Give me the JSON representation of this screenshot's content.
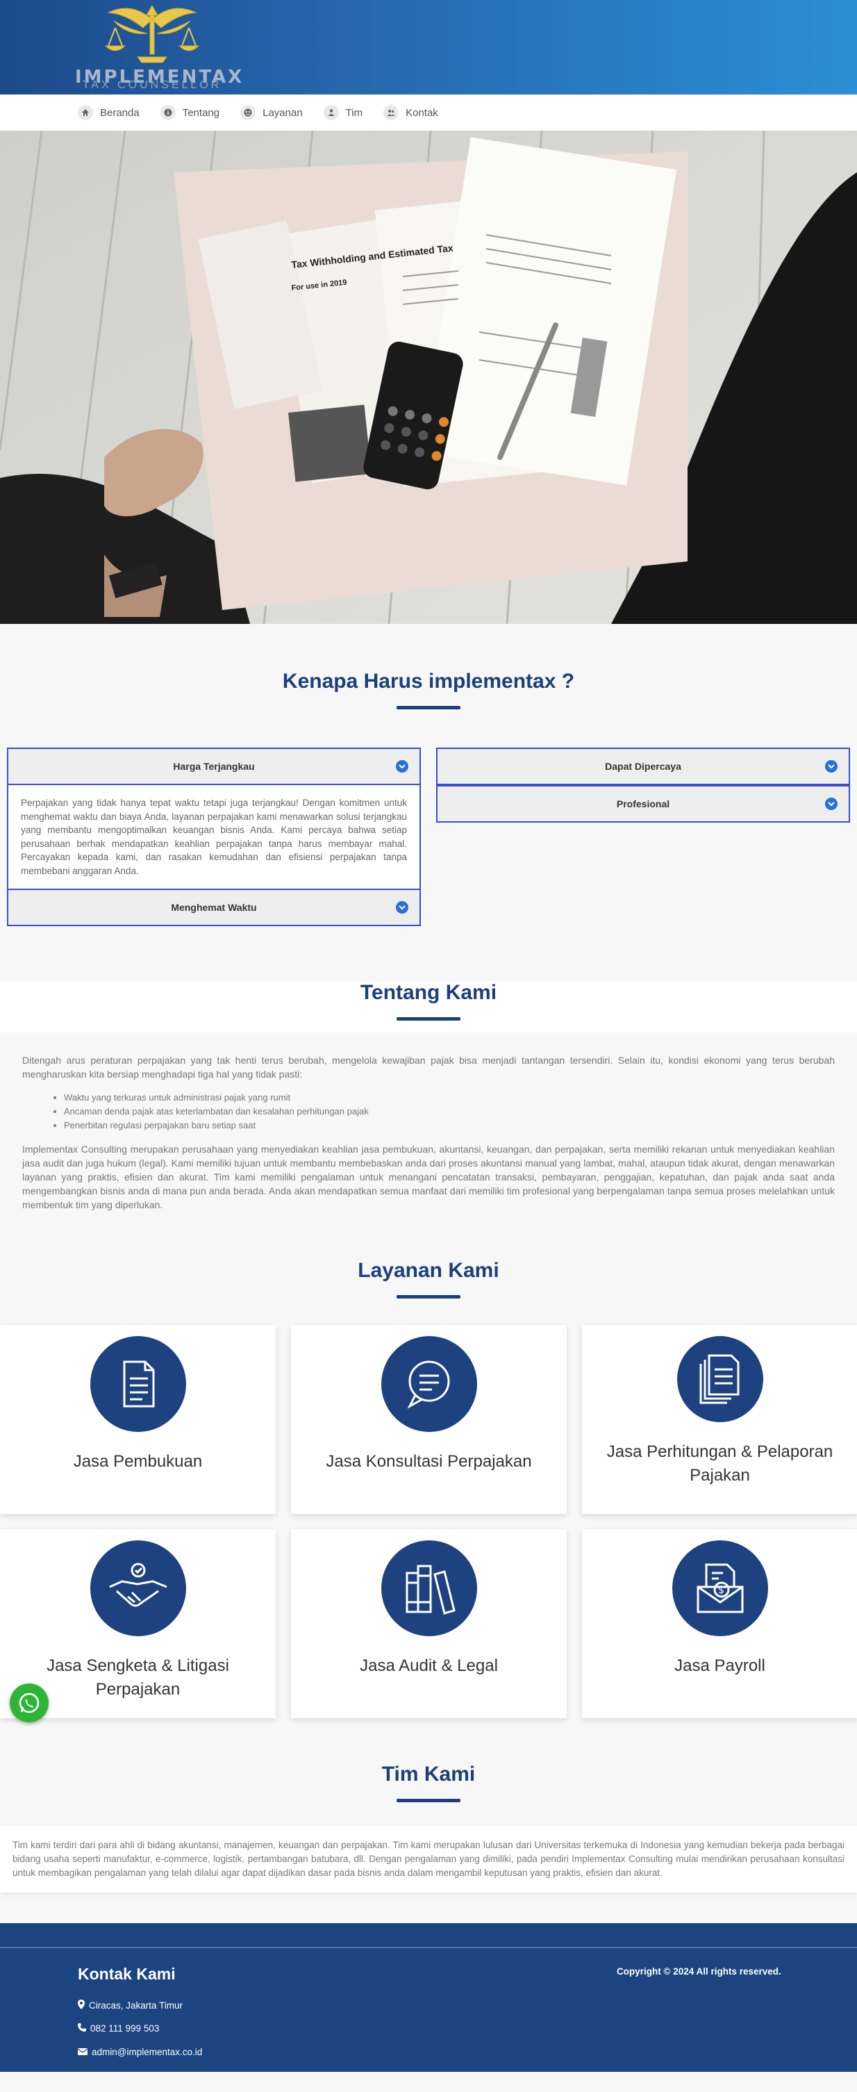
{
  "brand": {
    "name": "IMPLEMENTAX",
    "tagline": "TAX COUNSELLOR",
    "icon": "scales-eagle-logo"
  },
  "nav": [
    {
      "label": "Beranda",
      "icon": "home-icon"
    },
    {
      "label": "Tentang",
      "icon": "info-icon"
    },
    {
      "label": "Layanan",
      "icon": "services-icon"
    },
    {
      "label": "Tim",
      "icon": "team-icon"
    },
    {
      "label": "Kontak",
      "icon": "contact-icon"
    }
  ],
  "hero": {
    "doc_title": "Tax Withholding and Estimated Tax",
    "doc_year": "For use in 2019"
  },
  "why": {
    "title": "Kenapa Harus implementax ?",
    "left": [
      {
        "label": "Harga Terjangkau",
        "expanded": true,
        "body": "Perpajakan yang tidak hanya tepat waktu tetapi juga terjangkau! Dengan komitmen untuk menghemat waktu dan biaya Anda, layanan perpajakan kami menawarkan solusi terjangkau yang membantu mengoptimalkan keuangan bisnis Anda. Kami percaya bahwa setiap perusahaan berhak mendapatkan keahlian perpajakan tanpa harus membayar mahal. Percayakan kepada kami, dan rasakan kemudahan dan efisiensi perpajakan tanpa membebani anggaran Anda."
      },
      {
        "label": "Menghemat Waktu",
        "expanded": false
      }
    ],
    "right": [
      {
        "label": "Dapat Dipercaya",
        "expanded": false
      },
      {
        "label": "Profesional",
        "expanded": false
      }
    ]
  },
  "about": {
    "title": "Tentang Kami",
    "intro": "Ditengah arus peraturan perpajakan yang tak henti terus berubah, mengelola kewajiban pajak bisa menjadi tantangan tersendiri. Selain itu, kondisi ekonomi yang terus berubah mengharuskan kita bersiap menghadapi tiga hal yang tidak pasti:",
    "points": [
      "Waktu yang terkuras untuk administrasi pajak yang rumit",
      "Ancaman denda pajak atas keterlambatan dan kesalahan perhitungan pajak",
      "Penerbitan regulasi perpajakan baru setiap saat"
    ],
    "body": "Implementax Consulting merupakan perusahaan yang menyediakan keahlian jasa pembukuan, akuntansi, keuangan, dan perpajakan, serta memiliki rekanan untuk menyediakan keahlian jasa audit dan juga hukum (legal). Kami memiliki tujuan untuk membantu membebaskan anda dari proses akuntansi manual yang lambat, mahal, ataupun tidak akurat, dengan menawarkan layanan yang praktis, efisien dan akurat. Tim kami memiliki pengalaman untuk menangani pencatatan transaksi, pembayaran, penggajian, kepatuhan, dan pajak anda saat anda mengembangkan bisnis anda di mana pun anda berada. Anda akan mendapatkan semua manfaat dari memiliki tim profesional yang berpengalaman tanpa semua proses melelahkan untuk membentuk tim yang diperlukan."
  },
  "services": {
    "title": "Layanan Kami",
    "items": [
      {
        "name": "Jasa Pembukuan",
        "icon": "document-icon"
      },
      {
        "name": "Jasa Konsultasi Perpajakan",
        "icon": "chat-bubble-icon"
      },
      {
        "name": "Jasa Perhitungan & Pelaporan Pajakan",
        "icon": "documents-stack-icon"
      },
      {
        "name": "Jasa Sengketa & Litigasi Perpajakan",
        "icon": "handshake-icon"
      },
      {
        "name": "Jasa Audit & Legal",
        "icon": "books-icon"
      },
      {
        "name": "Jasa Payroll",
        "icon": "payroll-envelope-icon"
      }
    ]
  },
  "team": {
    "title": "Tim Kami",
    "body": "Tim kami terdiri dari para ahli di bidang akuntansi, manajemen, keuangan dan perpajakan. Tim kami merupakan lulusan dari Universitas terkemuka di Indonesia yang kemudian bekerja pada berbagai bidang usaha seperti manufaktur, e-commerce, logistik, pertambangan batubara, dll. Dengan pengalaman yang dimiliki, pada pendiri Implementax Consulting mulai mendirikan perusahaan konsultasi untuk membagikan pengalaman yang telah dilalui agar dapat dijadikan dasar pada bisnis anda dalam mengambil keputusan yang praktis, efisien dan akurat."
  },
  "footer": {
    "title": "Kontak Kami",
    "address": "Ciracas, Jakarta Timur",
    "phone": "082 111 999 503",
    "email": "admin@implementax.co.id",
    "copyright": "Copyright © 2024 All rights reserved."
  },
  "colors": {
    "primary": "#1c3f7a",
    "accent": "#2672d6",
    "border": "#3b4bd1",
    "whatsapp": "#2fb535"
  }
}
